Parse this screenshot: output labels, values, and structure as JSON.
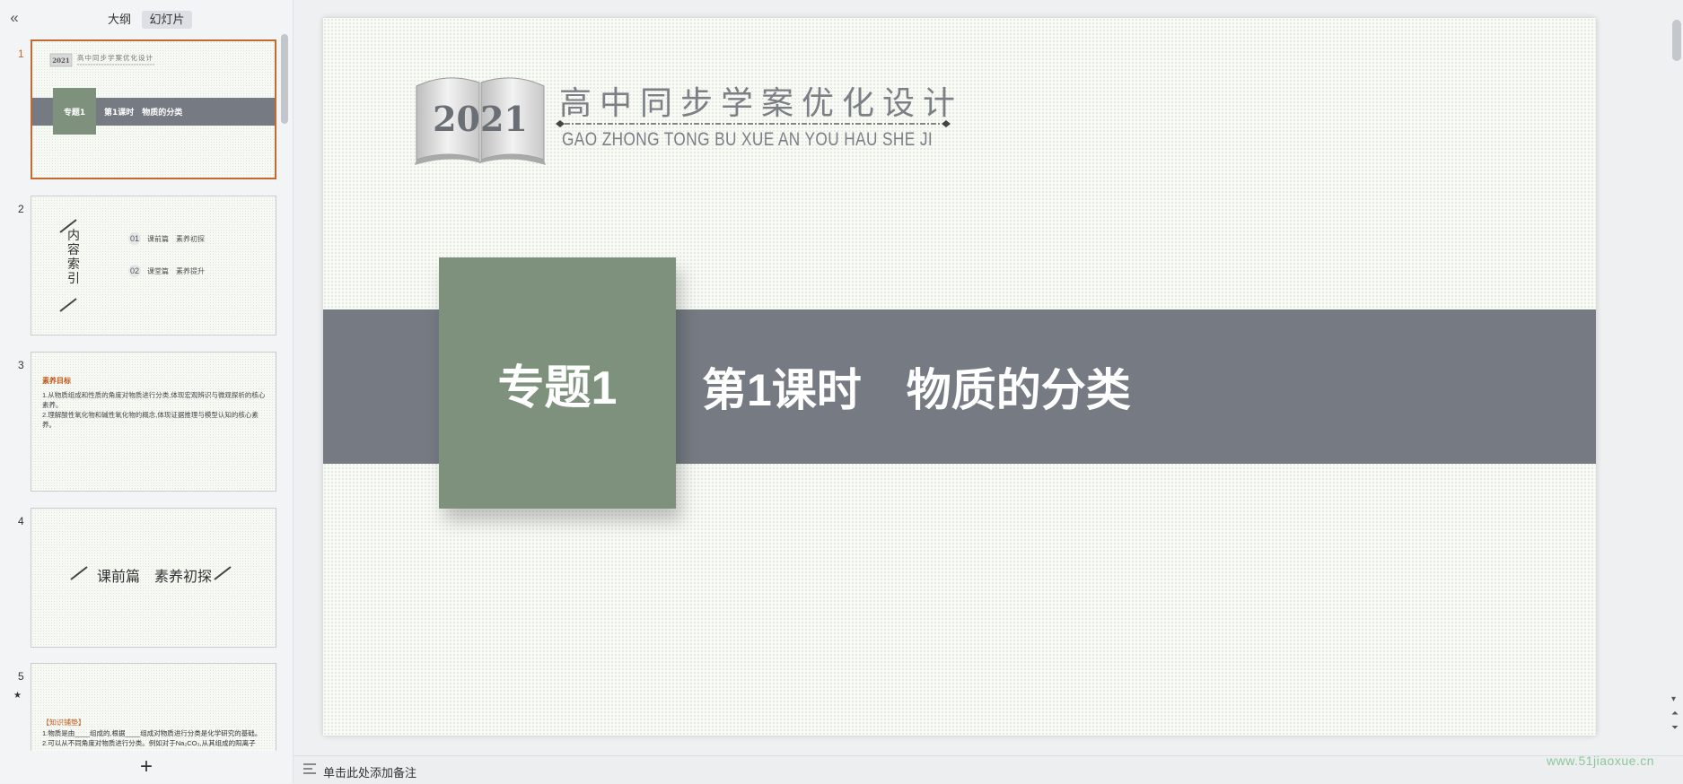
{
  "left_panel": {
    "collapse_glyph": "«",
    "tabs": {
      "outline": "大纲",
      "slides": "幻灯片"
    },
    "slide_numbers": [
      "1",
      "2",
      "3",
      "4",
      "5"
    ],
    "star_glyph": "★",
    "add_glyph": "+"
  },
  "thumbs": {
    "t1": {
      "year": "2021",
      "title": "高中同步学案优化设计",
      "tag": "专题1",
      "lesson": "第1课时　物质的分类"
    },
    "t2": {
      "index_chars": "内容索引",
      "items": [
        {
          "num": "01",
          "label": "课前篇　素养初探"
        },
        {
          "num": "02",
          "label": "课堂篇　素养提升"
        }
      ]
    },
    "t3": {
      "title": "素养目标",
      "lines": [
        "1.从物质组成和性质的角度对物质进行分类,体现宏观辨识与微观探析的核心素养。",
        "2.理解酸性氧化物和碱性氧化物的概念,体现证据推理与模型认知的核心素养。"
      ]
    },
    "t4": {
      "label": "课前篇　素养初探"
    },
    "t5": {
      "title": "【知识铺垫】",
      "lines": [
        "1.物质是由____组成的,根据____组成对物质进行分类是化学研究的基础。",
        "2.可以从不同角度对物质进行分类。例如对于Na₂CO₃,从其组成的阳离子"
      ]
    }
  },
  "slide": {
    "year": "2021",
    "title_cn": "高中同步学案优化设计",
    "title_pinyin": "GAO ZHONG TONG BU XUE AN YOU HAU SHE JI",
    "tag": "专题1",
    "lesson": "第1课时　物质的分类"
  },
  "notes": {
    "placeholder": "单击此处添加备注"
  },
  "watermark": "www.51jiaoxue.cn",
  "colors": {
    "band": "#767b83",
    "green_block": "#7d917c",
    "active_thumb_border": "#c56a2f",
    "accent_text": "#c05a1a"
  },
  "icons": [
    "collapse-icon",
    "book-icon",
    "pen-icon",
    "notes-icon",
    "star-icon",
    "add-icon"
  ]
}
